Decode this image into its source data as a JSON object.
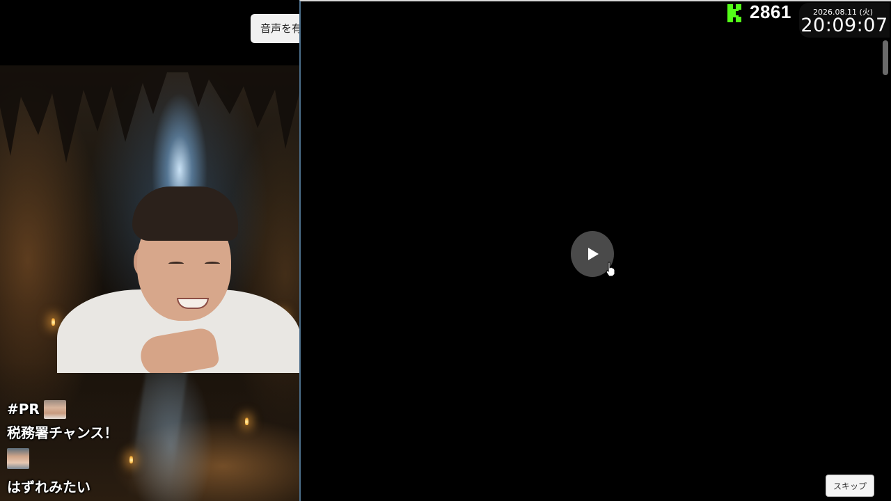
{
  "audio_button": {
    "label": "音声を有効"
  },
  "overlay": {
    "viewer_count": "2861",
    "date": "2026.08.11 (火)",
    "time": "20:09:07",
    "brand_color": "#53fc18"
  },
  "chat": {
    "pr_tag": "#PR",
    "message_1": "税務署チャンス！",
    "message_2": "はずれみたい"
  },
  "player": {
    "play_icon": "play-icon",
    "skip_label": "スキップ"
  }
}
